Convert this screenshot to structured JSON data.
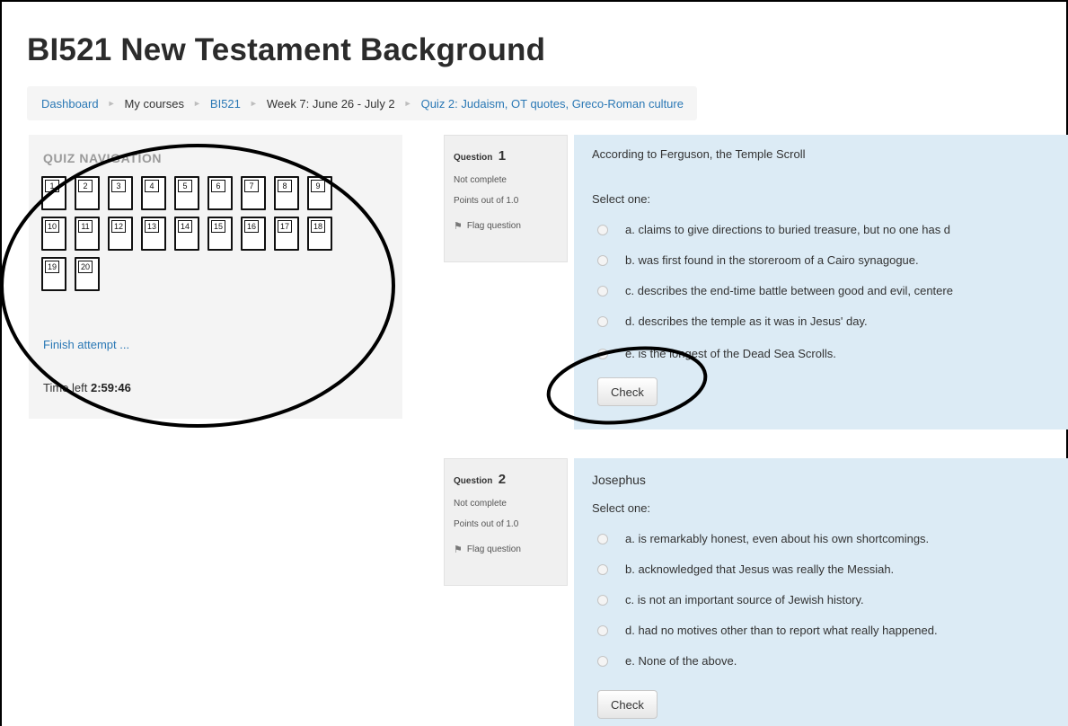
{
  "page": {
    "course_title": "BI521 New Testament Background"
  },
  "breadcrumb": {
    "dashboard": "Dashboard",
    "my_courses": "My courses",
    "course": "BI521",
    "week": "Week 7: June 26 - July 2",
    "quiz": "Quiz 2: Judaism, OT quotes, Greco-Roman culture",
    "separator": "►"
  },
  "quiz_navigation": {
    "title": "QUIZ NAVIGATION",
    "buttons": [
      "1",
      "2",
      "3",
      "4",
      "5",
      "6",
      "7",
      "8",
      "9",
      "10",
      "11",
      "12",
      "13",
      "14",
      "15",
      "16",
      "17",
      "18",
      "19",
      "20"
    ],
    "finish_label": "Finish attempt ...",
    "time_left_label": "Time left",
    "time_left_value": "2:59:46"
  },
  "questions": [
    {
      "label": "Question",
      "number": "1",
      "state": "Not complete",
      "points": "Points out of 1.0",
      "flag_label": "Flag question",
      "text": "According to Ferguson, the Temple Scroll",
      "select_prompt": "Select one:",
      "options": [
        "a. claims to give directions to buried treasure, but no one has d",
        "b. was first found in the storeroom of a Cairo synagogue.",
        "c. describes the end-time battle between good and evil, centere",
        "d. describes the temple as it was in Jesus' day.",
        "e. is the longest of the Dead Sea Scrolls."
      ],
      "check_label": "Check"
    },
    {
      "label": "Question",
      "number": "2",
      "state": "Not complete",
      "points": "Points out of 1.0",
      "flag_label": "Flag question",
      "text": "Josephus",
      "select_prompt": "Select one:",
      "options": [
        "a. is remarkably honest, even about his own shortcomings.",
        "b. acknowledged that Jesus was really the Messiah.",
        "c. is not an important source of Jewish history.",
        "d. had no motives other than to report what really happened.",
        "e. None of the above."
      ],
      "check_label": "Check"
    }
  ],
  "colors": {
    "link": "#2a78b5",
    "question_bg": "#dcebf5",
    "info_bg": "#f0f0f0",
    "nav_bg": "#f4f4f4",
    "annotation": "#000000"
  },
  "icons": {
    "flag": "flag-icon",
    "radio": "radio-icon",
    "breadcrumb_separator": "chevron-right-icon"
  }
}
